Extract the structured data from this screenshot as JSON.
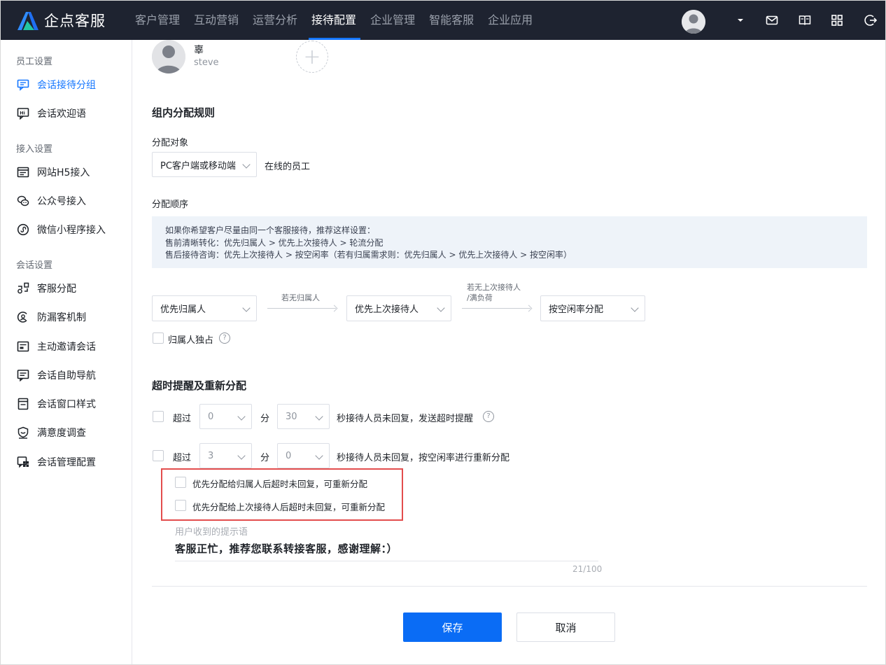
{
  "app": {
    "name": "企点客服"
  },
  "nav": [
    "客户管理",
    "互动营销",
    "运营分析",
    "接待配置",
    "企业管理",
    "智能客服",
    "企业应用"
  ],
  "nav_active": "接待配置",
  "sidebar": {
    "groups": [
      "员工设置",
      "接入设置",
      "会话设置"
    ],
    "items": [
      {
        "label": "会话接待分组",
        "icon": "chat-group-icon",
        "active": true
      },
      {
        "label": "会话欢迎语",
        "icon": "hi-message-icon"
      },
      {
        "label": "网站H5接入",
        "icon": "web-window-icon"
      },
      {
        "label": "公众号接入",
        "icon": "wechat-icon"
      },
      {
        "label": "微信小程序接入",
        "icon": "mini-program-icon"
      },
      {
        "label": "客服分配",
        "icon": "dispatch-icon"
      },
      {
        "label": "防漏客机制",
        "icon": "anti-leak-icon"
      },
      {
        "label": "主动邀请会话",
        "icon": "invite-icon"
      },
      {
        "label": "会话自助导航",
        "icon": "self-nav-icon"
      },
      {
        "label": "会话窗口样式",
        "icon": "window-style-icon"
      },
      {
        "label": "满意度调查",
        "icon": "satisfaction-icon"
      },
      {
        "label": "会话管理配置",
        "icon": "session-config-icon"
      }
    ]
  },
  "member": {
    "name": "辜",
    "account": "steve"
  },
  "rules": {
    "title": "组内分配规则",
    "target_label": "分配对象",
    "target_select": "PC客户端或移动端",
    "target_suffix": "在线的员工",
    "order_label": "分配顺序",
    "tip_lines": [
      "如果你希望客户尽量由同一个客服接待，推荐这样设置：",
      "售前清晰转化：优先归属人 > 优先上次接待人 > 轮流分配",
      "售后接待咨询：优先上次接待人 > 按空闲率（若有归属需求则：优先归属人 > 优先上次接待人 > 按空闲率）"
    ],
    "flow": {
      "step1": "优先归属人",
      "arrow1": "若无归属人",
      "step2": "优先上次接待人",
      "arrow2_line1": "若无上次接待人",
      "arrow2_line2": "/满负荷",
      "step3": "按空闲率分配"
    },
    "exclusive_label": "归属人独占"
  },
  "timeout": {
    "title": "超时提醒及重新分配",
    "row1": {
      "prefix": "超过",
      "min": "0",
      "min_unit": "分",
      "sec": "30",
      "suffix": "秒接待人员未回复，发送超时提醒"
    },
    "row2": {
      "prefix": "超过",
      "min": "3",
      "min_unit": "分",
      "sec": "0",
      "suffix": "秒接待人员未回复，按空闲率进行重新分配"
    },
    "options": [
      "优先分配给归属人后超时未回复，可重新分配",
      "优先分配给上次接待人后超时未回复，可重新分配"
    ],
    "hint_label": "用户收到的提示语",
    "hint_text": "客服正忙，推荐您联系转接客服，感谢理解：）",
    "hint_counter": "21/100"
  },
  "actions": {
    "save": "保存",
    "cancel": "取消"
  },
  "colors": {
    "topbar": "#1e2330",
    "primary": "#0a6cf5",
    "highlight": "#e34d4d"
  }
}
